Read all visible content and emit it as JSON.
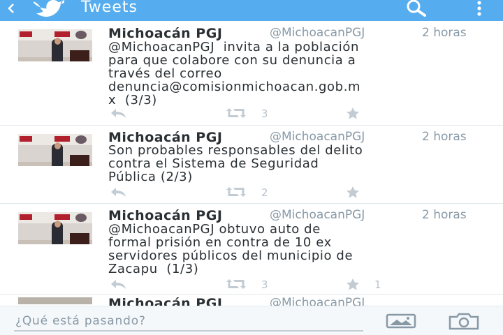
{
  "header": {
    "title": "Tweets",
    "icons": [
      "back-arrow-icon",
      "twitter-bird-icon",
      "search-icon",
      "overflow-menu-icon"
    ]
  },
  "tweets": [
    {
      "name": "Michoacán PGJ",
      "handle": "@MichoacanPGJ",
      "time": "2 horas",
      "text": "@MichoacanPGJ  invita a la población\npara que colabore con su denuncia a\ntravés del correo\ndenuncia@comisionmichoacan.gob.m\nx  (3/3)",
      "retweets": "3",
      "favorites": ""
    },
    {
      "name": "Michoacán PGJ",
      "handle": "@MichoacanPGJ",
      "time": "2 horas",
      "text": "Son probables responsables del delito\ncontra el Sistema de Seguridad\nPública (2/3)",
      "retweets": "2",
      "favorites": ""
    },
    {
      "name": "Michoacán PGJ",
      "handle": "@MichoacanPGJ",
      "time": "2 horas",
      "text": "@MichoacanPGJ obtuvo auto de\nformal prisión en contra de 10 ex\nservidores públicos del municipio de\nZacapu  (1/3)",
      "retweets": "3",
      "favorites": "1"
    },
    {
      "name": "Michoacán PGJ",
      "handle": "@MichoacanPGJ"
    }
  ],
  "composer": {
    "placeholder": "¿Qué está pasando?"
  },
  "colors": {
    "header": "#55acee",
    "name": "#292f33",
    "meta": "#8899a6",
    "action": "#b8c3cc"
  }
}
